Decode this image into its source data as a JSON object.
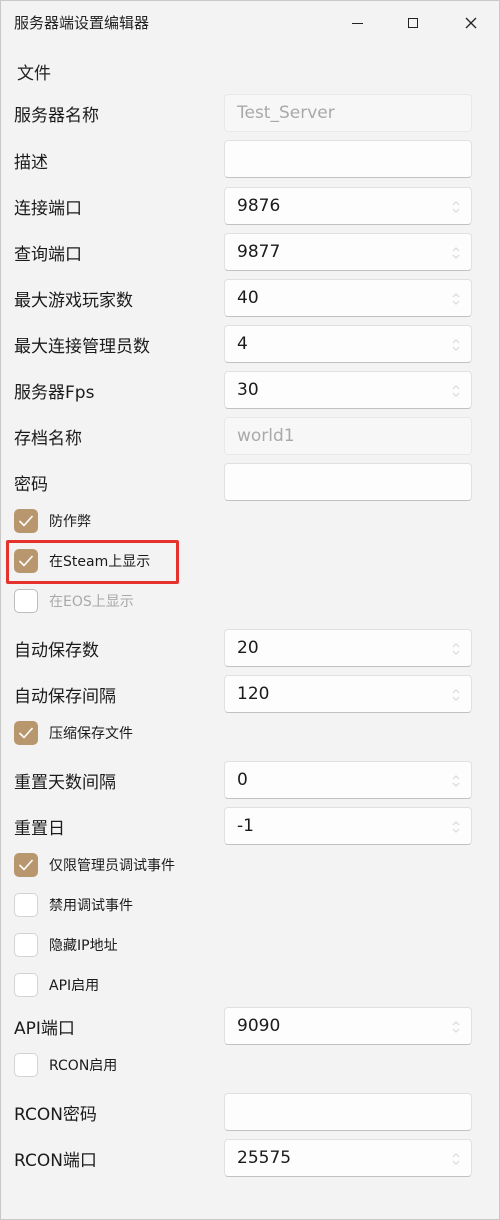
{
  "window": {
    "title": "服务器端设置编辑器"
  },
  "menu": {
    "file": "文件"
  },
  "fields": [
    {
      "label": "服务器名称",
      "value": "Test_Server",
      "disabled": true,
      "spinner": false
    },
    {
      "label": "描述",
      "value": "",
      "disabled": false,
      "spinner": false
    },
    {
      "label": "连接端口",
      "value": "9876",
      "disabled": false,
      "spinner": true
    },
    {
      "label": "查询端口",
      "value": "9877",
      "disabled": false,
      "spinner": true
    },
    {
      "label": "最大游戏玩家数",
      "value": "40",
      "disabled": false,
      "spinner": true
    },
    {
      "label": "最大连接管理员数",
      "value": "4",
      "disabled": false,
      "spinner": true
    },
    {
      "label": "服务器Fps",
      "value": "30",
      "disabled": false,
      "spinner": true
    },
    {
      "label": "存档名称",
      "value": "world1",
      "disabled": true,
      "spinner": false
    },
    {
      "label": "密码",
      "value": "",
      "disabled": false,
      "spinner": false
    },
    {
      "label": "自动保存数",
      "value": "20",
      "disabled": false,
      "spinner": true
    },
    {
      "label": "自动保存间隔",
      "value": "120",
      "disabled": false,
      "spinner": true
    },
    {
      "label": "重置天数间隔",
      "value": "0",
      "disabled": false,
      "spinner": true
    },
    {
      "label": "重置日",
      "value": "-1",
      "disabled": false,
      "spinner": true
    },
    {
      "label": "API端口",
      "value": "9090",
      "disabled": false,
      "spinner": true
    },
    {
      "label": "RCON密码",
      "value": "",
      "disabled": false,
      "spinner": false
    },
    {
      "label": "RCON端口",
      "value": "25575",
      "disabled": false,
      "spinner": true
    }
  ],
  "checkboxes": [
    {
      "label": "防作弊",
      "checked": true,
      "disabled": false
    },
    {
      "label": "在Steam上显示",
      "checked": true,
      "disabled": false
    },
    {
      "label": "在EOS上显示",
      "checked": false,
      "disabled": true
    },
    {
      "label": "压缩保存文件",
      "checked": true,
      "disabled": false
    },
    {
      "label": "仅限管理员调试事件",
      "checked": true,
      "disabled": false
    },
    {
      "label": "禁用调试事件",
      "checked": false,
      "disabled": false
    },
    {
      "label": "隐藏IP地址",
      "checked": false,
      "disabled": false
    },
    {
      "label": "API启用",
      "checked": false,
      "disabled": false
    },
    {
      "label": "RCON启用",
      "checked": false,
      "disabled": false
    }
  ],
  "colors": {
    "accent": "#b9976e",
    "highlight": "#e5322d"
  }
}
